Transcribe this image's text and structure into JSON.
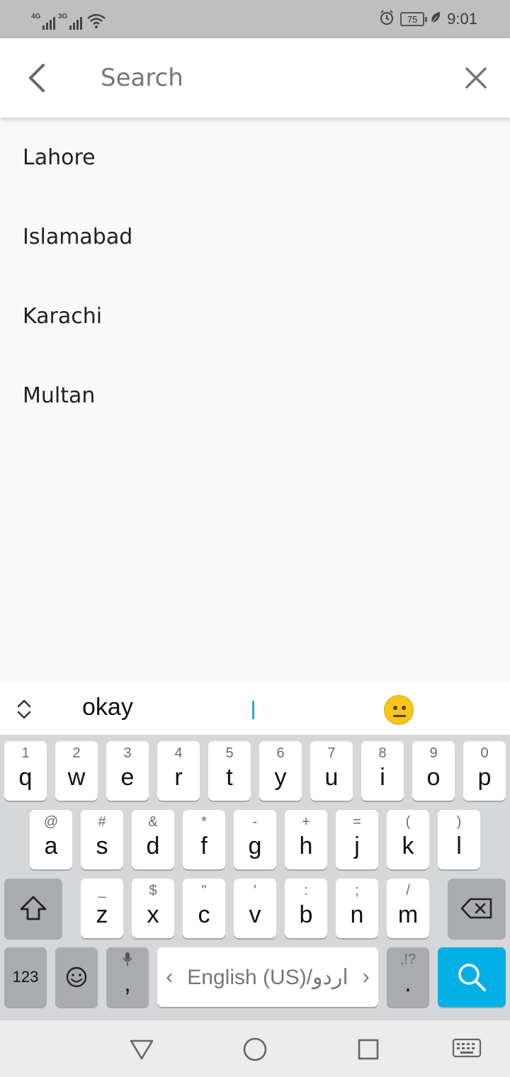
{
  "status_bar": {
    "network_1": "4G",
    "network_2": "3G",
    "battery": "75",
    "time": "9:01",
    "icons": [
      "signal-icon",
      "wifi-icon",
      "alarm-icon",
      "battery-icon",
      "leaf-icon"
    ]
  },
  "app_bar": {
    "search_placeholder": "Search",
    "icons": [
      "back-arrow-icon",
      "close-icon"
    ]
  },
  "results": [
    {
      "label": "Lahore"
    },
    {
      "label": "Islamabad"
    },
    {
      "label": "Karachi"
    },
    {
      "label": "Multan"
    }
  ],
  "keyboard": {
    "suggestion": "okay",
    "row1": [
      {
        "hint": "1",
        "key": "q"
      },
      {
        "hint": "2",
        "key": "w"
      },
      {
        "hint": "3",
        "key": "e"
      },
      {
        "hint": "4",
        "key": "r"
      },
      {
        "hint": "5",
        "key": "t"
      },
      {
        "hint": "6",
        "key": "y"
      },
      {
        "hint": "7",
        "key": "u"
      },
      {
        "hint": "8",
        "key": "i"
      },
      {
        "hint": "9",
        "key": "o"
      },
      {
        "hint": "0",
        "key": "p"
      }
    ],
    "row2": [
      {
        "hint": "@",
        "key": "a"
      },
      {
        "hint": "#",
        "key": "s"
      },
      {
        "hint": "&",
        "key": "d"
      },
      {
        "hint": "*",
        "key": "f"
      },
      {
        "hint": "-",
        "key": "g"
      },
      {
        "hint": "+",
        "key": "h"
      },
      {
        "hint": "=",
        "key": "j"
      },
      {
        "hint": "(",
        "key": "k"
      },
      {
        "hint": ")",
        "key": "l"
      }
    ],
    "row3": [
      {
        "hint": "_",
        "key": "z"
      },
      {
        "hint": "$",
        "key": "x"
      },
      {
        "hint": "\"",
        "key": "c"
      },
      {
        "hint": "'",
        "key": "v"
      },
      {
        "hint": ":",
        "key": "b"
      },
      {
        "hint": ";",
        "key": "n"
      },
      {
        "hint": "/",
        "key": "m"
      }
    ],
    "numbers_key": "123",
    "comma_key": ",",
    "space_label": "English (US)/اردو",
    "space_left_arrow": "‹",
    "space_right_arrow": "›",
    "period_hint": ",!?",
    "period_key": ".",
    "accent_color": "#03b0e6"
  },
  "nav_bar": {
    "icons": [
      "back-triangle-icon",
      "home-circle-icon",
      "recents-square-icon",
      "keyboard-hide-icon"
    ]
  }
}
